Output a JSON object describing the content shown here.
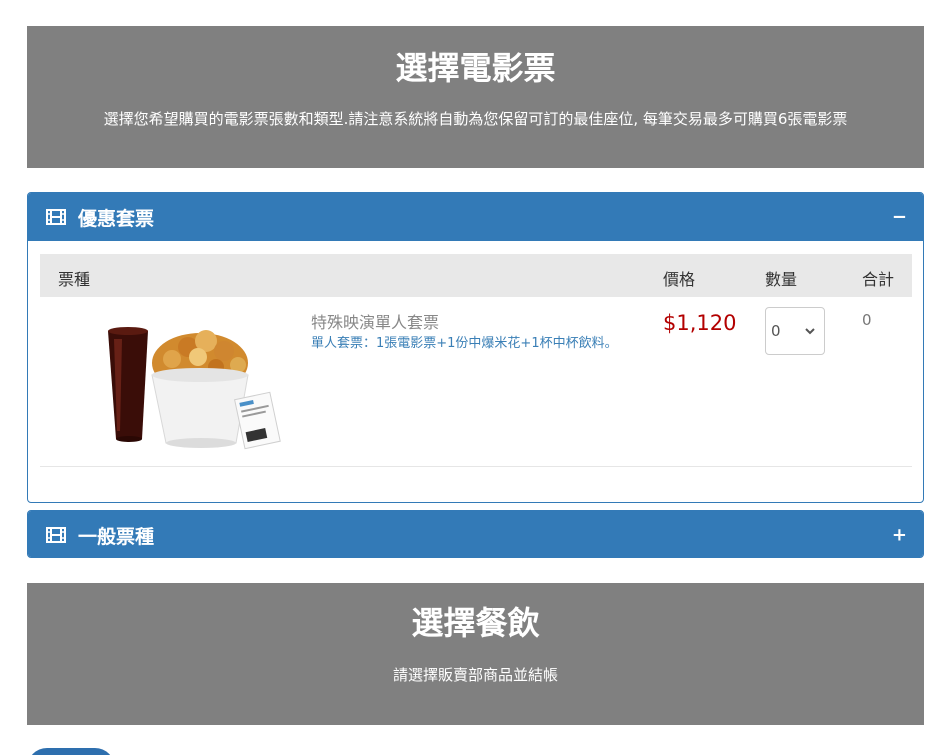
{
  "tickets_hero": {
    "title": "選擇電影票",
    "subtitle": "選擇您希望購買的電影票張數和類型.請注意系統將自動為您保留可訂的最佳座位, 每筆交易最多可購買6張電影票"
  },
  "combo_panel": {
    "title": "優惠套票",
    "toggle": "−",
    "icon": "film-icon",
    "columns": {
      "type": "票種",
      "price": "價格",
      "qty": "數量",
      "total": "合計"
    },
    "rows": [
      {
        "name": "特殊映演單人套票",
        "description": "單人套票：1張電影票+1份中爆米花+1杯中杯飲料。",
        "price": "$1,120",
        "qty": "0",
        "total": "0"
      }
    ]
  },
  "general_panel": {
    "title": "一般票種",
    "toggle": "+",
    "icon": "film-icon"
  },
  "food_hero": {
    "title": "選擇餐飲",
    "subtitle": "請選擇販賣部商品並結帳"
  },
  "colors": {
    "hero_bg": "#808080",
    "panel_blue": "#337ab7",
    "price_red": "#b30000",
    "link_blue": "#3a7fb6"
  }
}
